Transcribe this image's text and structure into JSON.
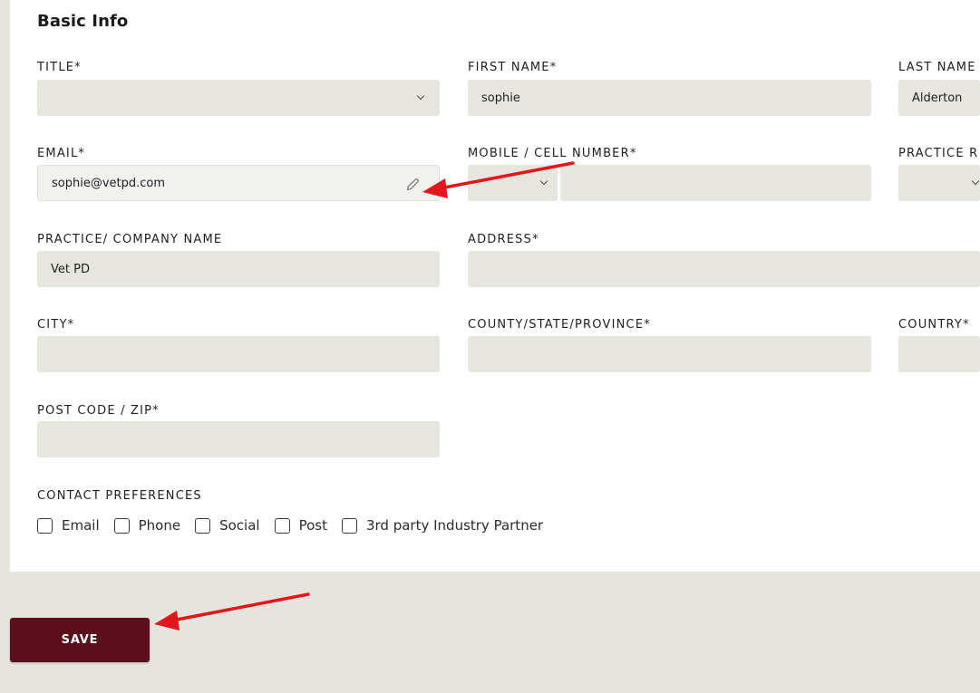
{
  "form": {
    "section_title": "Basic Info",
    "fields": {
      "title": {
        "label": "TITLE*",
        "value": ""
      },
      "first_name": {
        "label": "FIRST NAME*",
        "value": "sophie"
      },
      "last_name": {
        "label": "LAST NAME",
        "value": "Alderton"
      },
      "email": {
        "label": "EMAIL*",
        "value": "sophie@vetpd.com"
      },
      "mobile": {
        "label": "MOBILE / CELL NUMBER*",
        "value": ""
      },
      "practice_role": {
        "label": "PRACTICE R",
        "value": ""
      },
      "company": {
        "label": "PRACTICE/ COMPANY NAME",
        "value": "Vet PD"
      },
      "address": {
        "label": "ADDRESS*",
        "value": ""
      },
      "city": {
        "label": "CITY*",
        "value": ""
      },
      "county": {
        "label": "COUNTY/STATE/PROVINCE*",
        "value": ""
      },
      "country": {
        "label": "COUNTRY*",
        "value": ""
      },
      "postcode": {
        "label": "POST CODE / ZIP*",
        "value": ""
      }
    },
    "contact_preferences": {
      "label": "CONTACT PREFERENCES",
      "options": [
        "Email",
        "Phone",
        "Social",
        "Post",
        "3rd party Industry Partner"
      ]
    },
    "save_label": "SAVE"
  },
  "annotations": {
    "arrow_color": "#e3161b"
  },
  "colors": {
    "accent": "#5c0e1d",
    "field_bg": "#e6e5de",
    "page_bg": "#e6e4dd"
  },
  "icons": {
    "email_edit": "pencil-icon",
    "select": "chevron-down-icon"
  }
}
